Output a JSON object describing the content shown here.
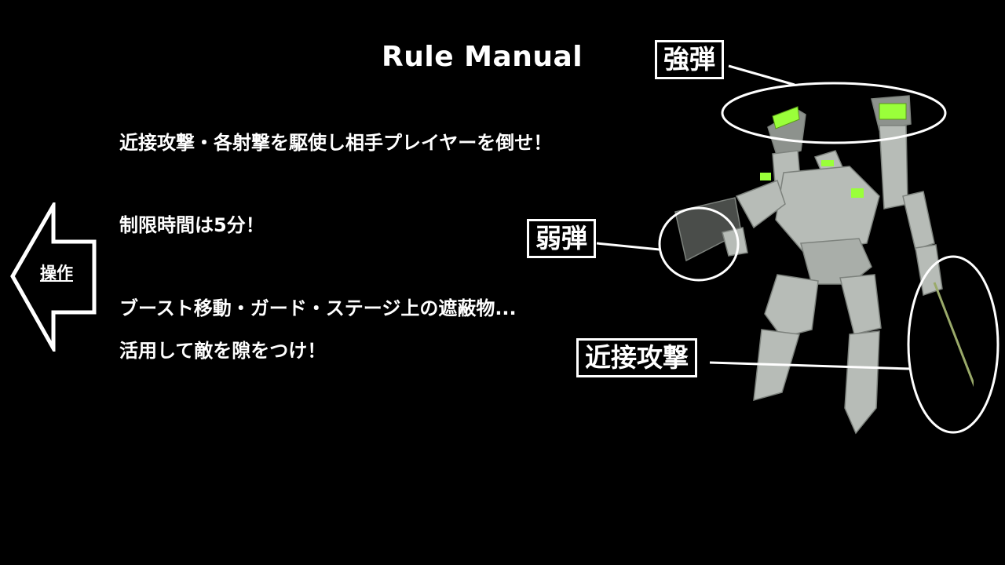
{
  "title": "Rule Manual",
  "rules": [
    "近接攻撃・各射撃を駆使し相手プレイヤーを倒せ！",
    "制限時間は5分！",
    "ブースト移動・ガード・ステージ上の遮蔽物...",
    "活用して敵を隙をつけ！"
  ],
  "nav": {
    "back_label": "操作",
    "icon": "left-arrow-icon"
  },
  "callouts": {
    "strong_shot": "強弾",
    "weak_shot": "弱弾",
    "melee": "近接攻撃"
  },
  "colors": {
    "background": "#000000",
    "text": "#ffffff",
    "accent": "#9aff3a"
  }
}
